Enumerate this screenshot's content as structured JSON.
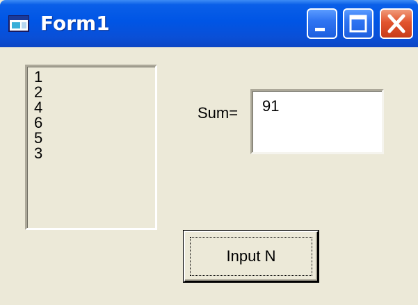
{
  "window": {
    "title": "Form1",
    "icons": {
      "app": "form-window-icon",
      "minimize": "minimize-icon",
      "maximize": "maximize-icon",
      "close": "close-icon"
    }
  },
  "listbox": {
    "items": [
      "1",
      "2",
      "4",
      "6",
      "5",
      "3"
    ]
  },
  "sum": {
    "label": "Sum=",
    "value": "91"
  },
  "input_button": {
    "label": "Input N"
  },
  "colors": {
    "titlebar": "#0055e5",
    "close_button": "#e2552f",
    "face": "#ece9d8"
  }
}
